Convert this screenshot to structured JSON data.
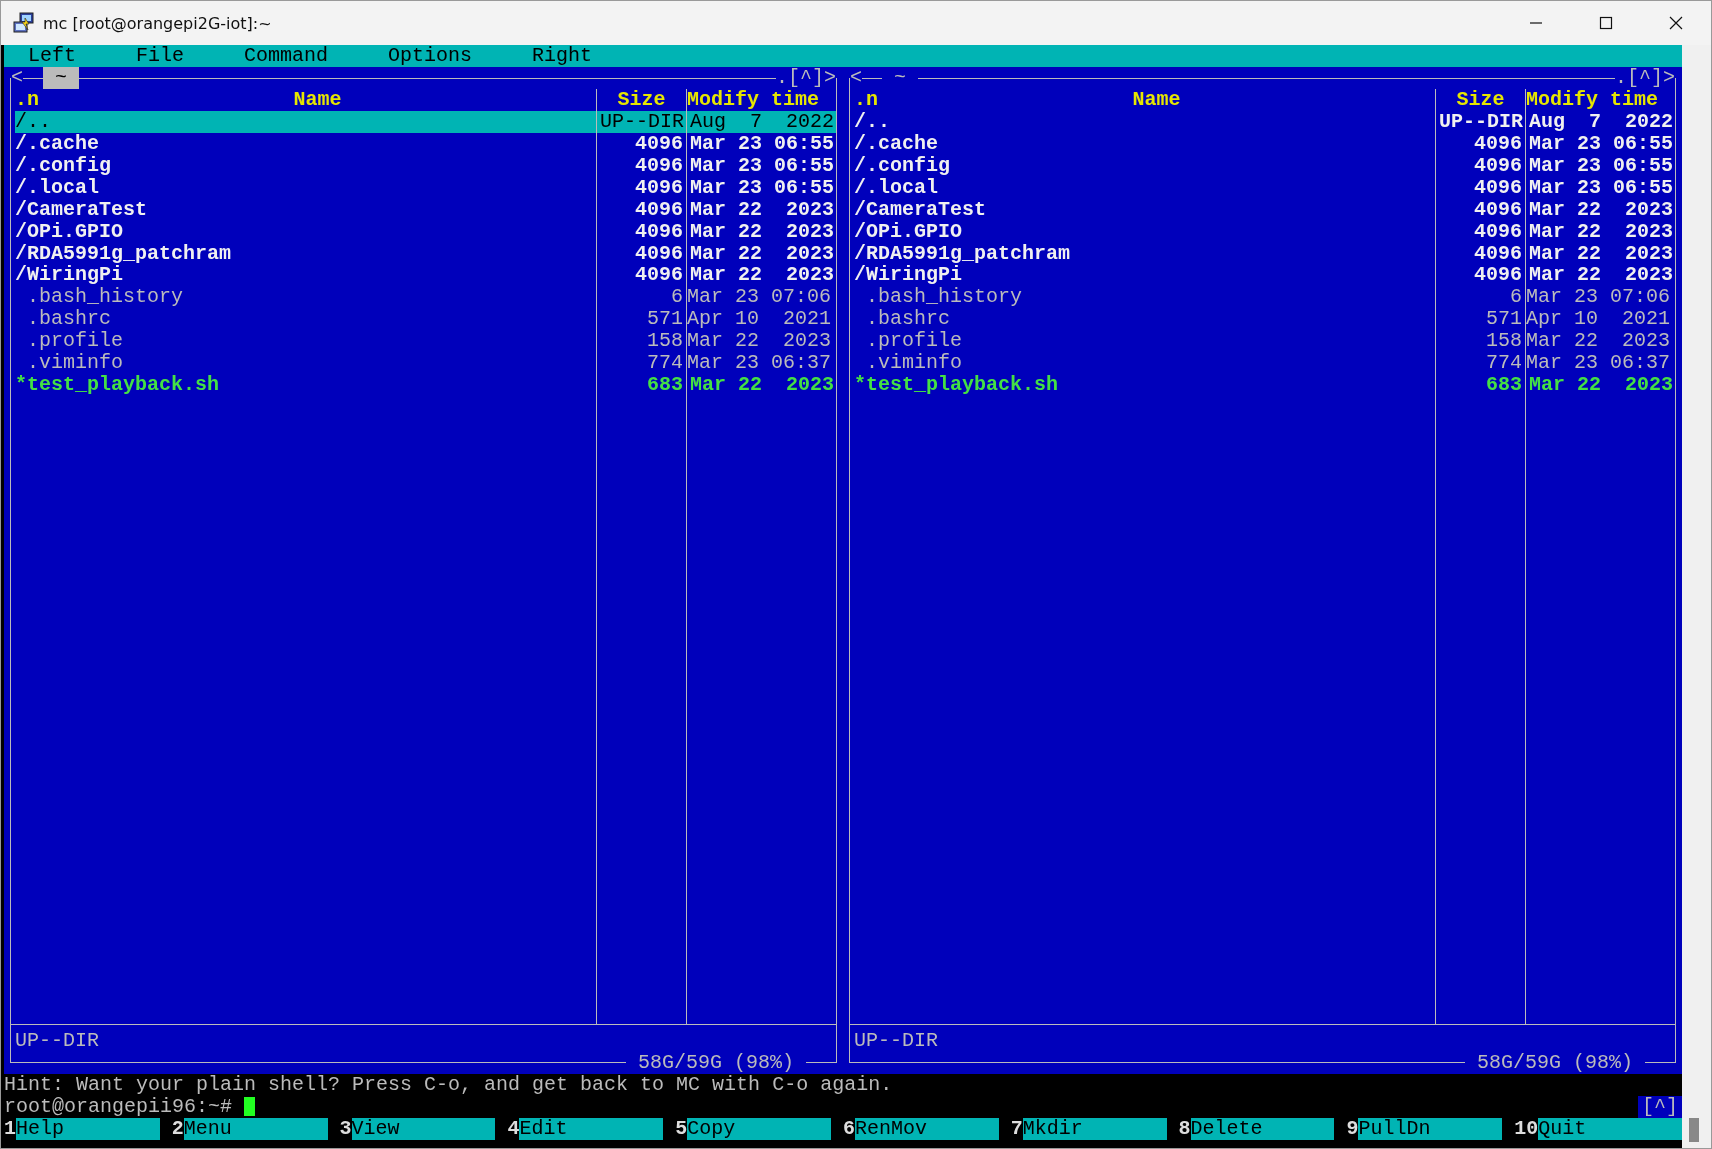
{
  "window": {
    "title": "mc [root@orangepi2G-iot]:~"
  },
  "menu": [
    "Left",
    "File",
    "Command",
    "Options",
    "Right"
  ],
  "panels": [
    {
      "active": true,
      "nav_left": "<",
      "path": "~",
      "nav_right": ".[^]>",
      "columns": [
        ".n",
        "Name",
        "Size",
        "Modify time"
      ],
      "status": "UP--DIR",
      "disk": "58G/59G (98%)",
      "rows": [
        {
          "name": "/..",
          "size": "UP--DIR",
          "modified": "Aug  7  2022",
          "kind": "dir",
          "selected": true
        },
        {
          "name": "/.cache",
          "size": "4096",
          "modified": "Mar 23 06:55",
          "kind": "dir",
          "selected": false
        },
        {
          "name": "/.config",
          "size": "4096",
          "modified": "Mar 23 06:55",
          "kind": "dir",
          "selected": false
        },
        {
          "name": "/.local",
          "size": "4096",
          "modified": "Mar 23 06:55",
          "kind": "dir",
          "selected": false
        },
        {
          "name": "/CameraTest",
          "size": "4096",
          "modified": "Mar 22  2023",
          "kind": "dir",
          "selected": false
        },
        {
          "name": "/OPi.GPIO",
          "size": "4096",
          "modified": "Mar 22  2023",
          "kind": "dir",
          "selected": false
        },
        {
          "name": "/RDA5991g_patchram",
          "size": "4096",
          "modified": "Mar 22  2023",
          "kind": "dir",
          "selected": false
        },
        {
          "name": "/WiringPi",
          "size": "4096",
          "modified": "Mar 22  2023",
          "kind": "dir",
          "selected": false
        },
        {
          "name": ".bash_history",
          "size": "6",
          "modified": "Mar 23 07:06",
          "kind": "file",
          "selected": false
        },
        {
          "name": ".bashrc",
          "size": "571",
          "modified": "Apr 10  2021",
          "kind": "file",
          "selected": false
        },
        {
          "name": ".profile",
          "size": "158",
          "modified": "Mar 22  2023",
          "kind": "file",
          "selected": false
        },
        {
          "name": ".viminfo",
          "size": "774",
          "modified": "Mar 23 06:37",
          "kind": "file",
          "selected": false
        },
        {
          "name": "*test_playback.sh",
          "size": "683",
          "modified": "Mar 22  2023",
          "kind": "exec",
          "selected": false
        }
      ]
    },
    {
      "active": false,
      "nav_left": "<",
      "path": "~",
      "nav_right": ".[^]>",
      "columns": [
        ".n",
        "Name",
        "Size",
        "Modify time"
      ],
      "status": "UP--DIR",
      "disk": "58G/59G (98%)",
      "rows": [
        {
          "name": "/..",
          "size": "UP--DIR",
          "modified": "Aug  7  2022",
          "kind": "dir",
          "selected": false
        },
        {
          "name": "/.cache",
          "size": "4096",
          "modified": "Mar 23 06:55",
          "kind": "dir",
          "selected": false
        },
        {
          "name": "/.config",
          "size": "4096",
          "modified": "Mar 23 06:55",
          "kind": "dir",
          "selected": false
        },
        {
          "name": "/.local",
          "size": "4096",
          "modified": "Mar 23 06:55",
          "kind": "dir",
          "selected": false
        },
        {
          "name": "/CameraTest",
          "size": "4096",
          "modified": "Mar 22  2023",
          "kind": "dir",
          "selected": false
        },
        {
          "name": "/OPi.GPIO",
          "size": "4096",
          "modified": "Mar 22  2023",
          "kind": "dir",
          "selected": false
        },
        {
          "name": "/RDA5991g_patchram",
          "size": "4096",
          "modified": "Mar 22  2023",
          "kind": "dir",
          "selected": false
        },
        {
          "name": "/WiringPi",
          "size": "4096",
          "modified": "Mar 22  2023",
          "kind": "dir",
          "selected": false
        },
        {
          "name": ".bash_history",
          "size": "6",
          "modified": "Mar 23 07:06",
          "kind": "file",
          "selected": false
        },
        {
          "name": ".bashrc",
          "size": "571",
          "modified": "Apr 10  2021",
          "kind": "file",
          "selected": false
        },
        {
          "name": ".profile",
          "size": "158",
          "modified": "Mar 22  2023",
          "kind": "file",
          "selected": false
        },
        {
          "name": ".viminfo",
          "size": "774",
          "modified": "Mar 23 06:37",
          "kind": "file",
          "selected": false
        },
        {
          "name": "*test_playback.sh",
          "size": "683",
          "modified": "Mar 22  2023",
          "kind": "exec",
          "selected": false
        }
      ]
    }
  ],
  "hint": "Hint: Want your plain shell? Press C-o, and get back to MC with C-o again.",
  "prompt": "root@orangepii96:~#",
  "subshell_indicator": "[^]",
  "keybar": [
    {
      "key": "1",
      "label": "Help"
    },
    {
      "key": "2",
      "label": "Menu"
    },
    {
      "key": "3",
      "label": "View"
    },
    {
      "key": "4",
      "label": "Edit"
    },
    {
      "key": "5",
      "label": "Copy"
    },
    {
      "key": "6",
      "label": "RenMov"
    },
    {
      "key": "7",
      "label": "Mkdir"
    },
    {
      "key": "8",
      "label": "Delete"
    },
    {
      "key": "9",
      "label": "PullDn"
    },
    {
      "key": "10",
      "label": "Quit"
    }
  ]
}
